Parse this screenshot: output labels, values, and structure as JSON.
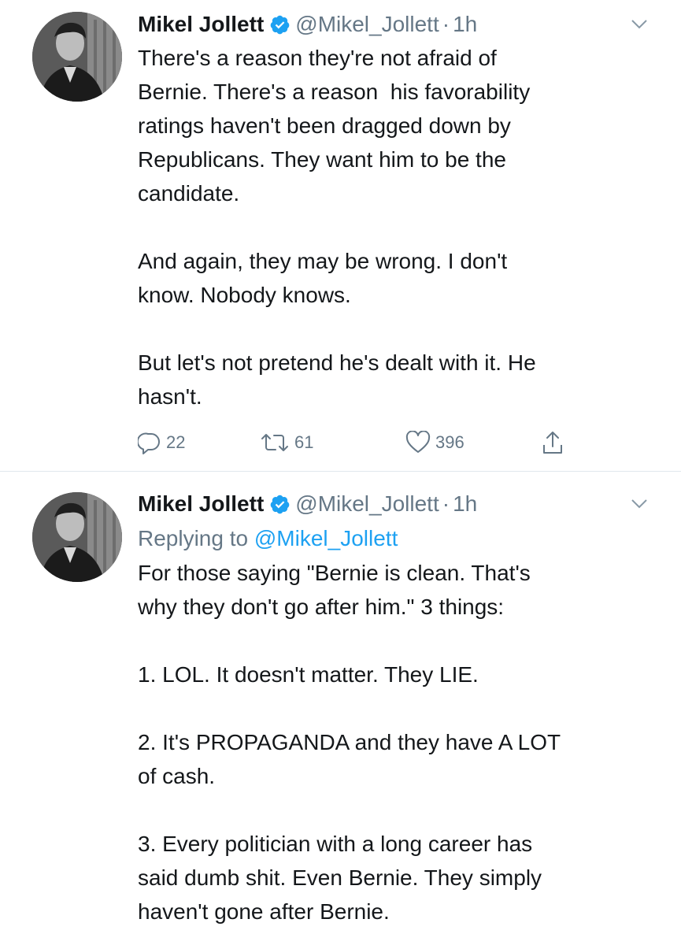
{
  "tweets": [
    {
      "author_name": "Mikel Jollett",
      "handle": "@Mikel_Jollett",
      "separator": "·",
      "time": "1h",
      "text": "There's a reason they're not afraid of\nBernie. There's a reason  his favorability\nratings haven't been dragged down by\nRepublicans. They want him to be the\ncandidate.\n\nAnd again, they may be wrong. I don't\nknow. Nobody knows.\n\nBut let's not pretend he's dealt with it. He\nhasn't.",
      "replies": "22",
      "retweets": "61",
      "likes": "396"
    },
    {
      "author_name": "Mikel Jollett",
      "handle": "@Mikel_Jollett",
      "separator": "·",
      "time": "1h",
      "replying_prefix": "Replying to",
      "replying_to": "@Mikel_Jollett",
      "text": "For those saying \"Bernie is clean. That's\nwhy they don't go after him.\" 3 things:\n\n1. LOL. It doesn't matter. They LIE.\n\n2. It's PROPAGANDA and they have A LOT\nof cash.\n\n3. Every politician with a long career has\nsaid dumb shit. Even Bernie. They simply\nhaven't gone after Bernie."
    }
  ],
  "icons": {
    "verified": "verified-badge-icon",
    "chevron": "chevron-down-icon",
    "reply": "reply-icon",
    "retweet": "retweet-icon",
    "like": "heart-icon",
    "share": "share-icon"
  },
  "colors": {
    "text": "#14171a",
    "secondary": "#657786",
    "link": "#1da1f2",
    "divider": "#e1e8ed"
  }
}
